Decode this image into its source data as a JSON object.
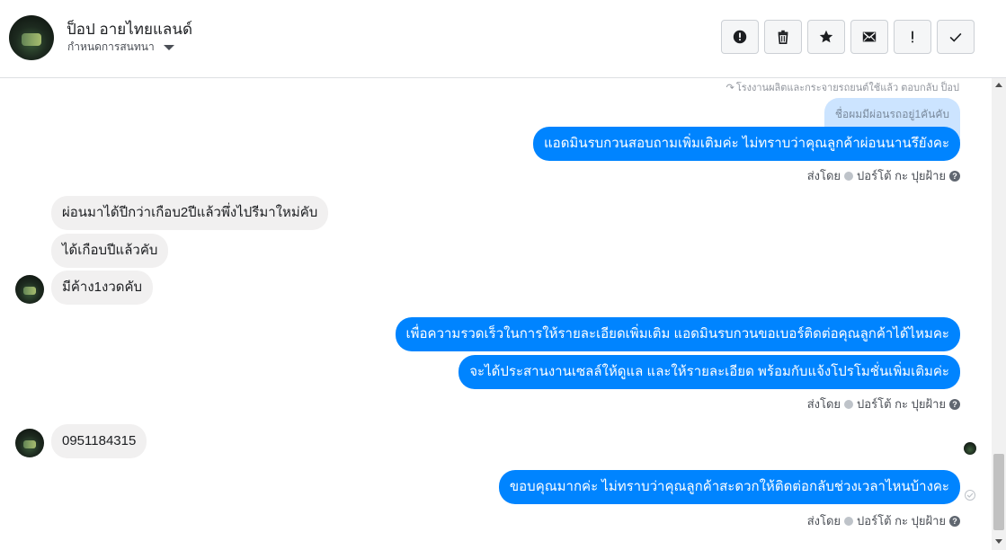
{
  "header": {
    "contact_name": "ป็อป อายไทยแลนด์",
    "subtitle": "กำหนดการสนทนา",
    "actions": [
      {
        "name": "report",
        "icon": "alert-circle-icon"
      },
      {
        "name": "delete",
        "icon": "trash-icon"
      },
      {
        "name": "star",
        "icon": "star-icon"
      },
      {
        "name": "mail",
        "icon": "envelope-icon"
      },
      {
        "name": "important",
        "icon": "exclamation-icon"
      },
      {
        "name": "done",
        "icon": "check-icon"
      }
    ]
  },
  "thread": {
    "reply_hint": "โรงงานผลิตและกระจายรถยนต์ใช้แล้ว ตอบกลับ ป็อป",
    "quoted_text": "ชื่อผมมีผ่อนรถอยู่1คันคับ",
    "out_msg_1": "แอดมินรบกวนสอบถามเพิ่มเติมค่ะ ไม่ทราบว่าคุณลูกค้าผ่อนนานรึยังคะ",
    "sent_by_label": "ส่งโดย",
    "sender_name": "ปอร์โต้ กะ ปุยฝ้าย",
    "in_msg_1": "ผ่อนมาได้ปีกว่าเกือบ2ปีแล้วพึ่งไปรีมาใหม่คับ",
    "in_msg_2": "ได้เกือบปีแล้วคับ",
    "in_msg_3": "มีค้าง1งวดคับ",
    "out_msg_2": "เพื่อความรวดเร็วในการให้รายละเอียดเพิ่มเติม แอดมินรบกวนขอเบอร์ติดต่อคุณลูกค้าได้ไหมคะ",
    "out_msg_3": "จะได้ประสานงานเซลล์ให้ดูแล และให้รายละเอียด พร้อมกับแจ้งโปรโมชั่นเพิ่มเติมค่ะ",
    "in_msg_4": "0951184315",
    "out_msg_4": "ขอบคุณมากค่ะ ไม่ทราบว่าคุณลูกค้าสะดวกให้ติดต่อกลับช่วงเวลาไหนบ้างคะ"
  },
  "colors": {
    "outgoing_bubble": "#0084ff",
    "incoming_bubble": "#f1f0f0",
    "quoted_bubble": "#cce4ff"
  }
}
